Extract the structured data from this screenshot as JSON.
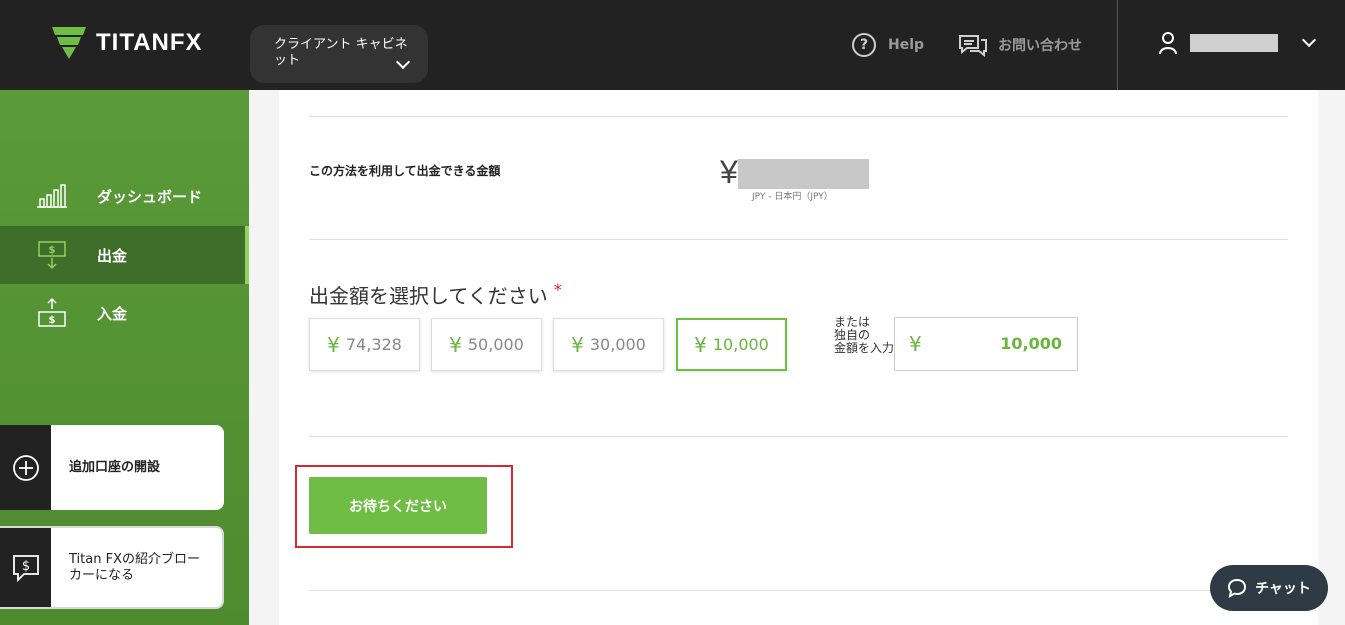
{
  "header": {
    "brand": "TITANFX",
    "cabinet_label": "クライアント キャビネット",
    "help_label": "Help",
    "contact_label": "お問い合わせ"
  },
  "sidebar": {
    "items": [
      {
        "label": "ダッシュボード",
        "icon": "bar-chart-icon"
      },
      {
        "label": "出金",
        "icon": "withdraw-icon",
        "active": true
      },
      {
        "label": "入金",
        "icon": "deposit-icon"
      }
    ],
    "cards": [
      {
        "label": "追加口座の開設",
        "icon": "plus-circle-icon"
      },
      {
        "label": "Titan FXの紹介ブローカーになる",
        "icon": "dollar-chat-icon"
      }
    ]
  },
  "main": {
    "available_label": "この方法を利用して出金できる金額",
    "available_currency_symbol": "¥",
    "available_currency_note": "JPY - 日本円（JPY）",
    "select_title": "出金額を選択してください",
    "required_mark": "*",
    "amount_options": [
      {
        "symbol": "¥",
        "value": "74,328",
        "selected": false
      },
      {
        "symbol": "¥",
        "value": "50,000",
        "selected": false
      },
      {
        "symbol": "¥",
        "value": "30,000",
        "selected": false
      },
      {
        "symbol": "¥",
        "value": "10,000",
        "selected": true
      }
    ],
    "or_text_line1": "または",
    "or_text_line2": "独自の",
    "or_text_line3": "金額を入力",
    "custom_amount_symbol": "¥",
    "custom_amount_value": "10,000",
    "submit_label": "お待ちください"
  },
  "chat": {
    "label": "チャット"
  },
  "colors": {
    "brand_green": "#6fbd44",
    "header_bg": "#222222",
    "sidebar_green": "#5a9a38",
    "highlight_red": "#d12a34"
  }
}
